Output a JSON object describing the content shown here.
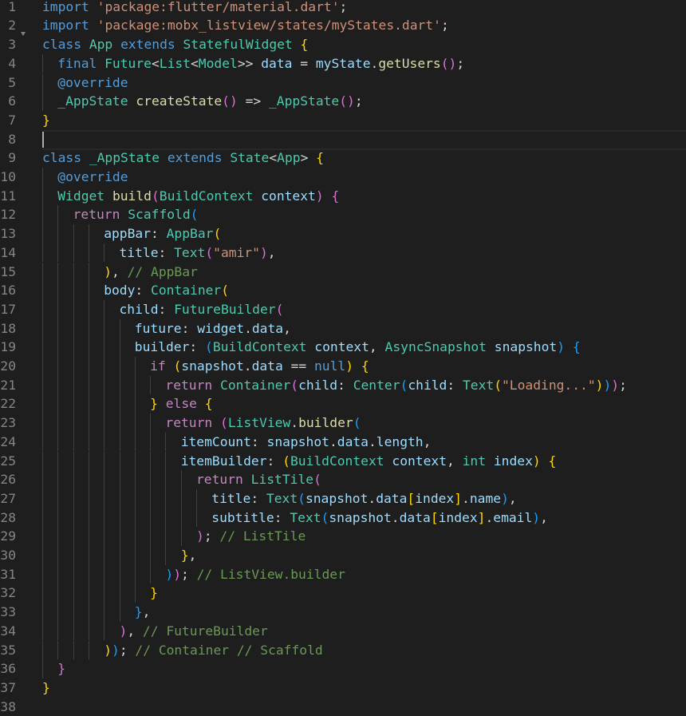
{
  "editor": {
    "language": "dart",
    "current_line": 8,
    "colors": {
      "background": "#1e1e1e",
      "keyword": "#569cd6",
      "control": "#c586c0",
      "type": "#4ec9b0",
      "function": "#dcdcaa",
      "variable": "#9cdcfe",
      "string": "#ce9178",
      "comment": "#6a9955",
      "punctuation": "#d4d4d4",
      "bracket_1": "#ffd700",
      "bracket_2": "#da70d6",
      "bracket_3": "#179fff",
      "line_number": "#858585"
    },
    "lines": [
      {
        "n": "1",
        "indent": 0,
        "tokens": [
          [
            "kw",
            "import"
          ],
          [
            "p",
            " "
          ],
          [
            "str",
            "'package:flutter/material.dart'"
          ],
          [
            "p",
            ";"
          ]
        ]
      },
      {
        "n": "2",
        "indent": 0,
        "tokens": [
          [
            "kw",
            "import"
          ],
          [
            "p",
            " "
          ],
          [
            "str",
            "'package:mobx_listview/states/myStates.dart'"
          ],
          [
            "p",
            ";"
          ]
        ]
      },
      {
        "n": "3",
        "indent": 0,
        "tokens": [
          [
            "kw",
            "class"
          ],
          [
            "p",
            " "
          ],
          [
            "type",
            "App"
          ],
          [
            "p",
            " "
          ],
          [
            "kw",
            "extends"
          ],
          [
            "p",
            " "
          ],
          [
            "type",
            "StatefulWidget"
          ],
          [
            "p",
            " "
          ],
          [
            "b1",
            "{"
          ]
        ]
      },
      {
        "n": "4",
        "indent": 1,
        "tokens": [
          [
            "kw",
            "final"
          ],
          [
            "p",
            " "
          ],
          [
            "type",
            "Future"
          ],
          [
            "p",
            "<"
          ],
          [
            "type",
            "List"
          ],
          [
            "p",
            "<"
          ],
          [
            "type",
            "Model"
          ],
          [
            "p",
            ">> "
          ],
          [
            "var",
            "data"
          ],
          [
            "p",
            " = "
          ],
          [
            "var",
            "myState"
          ],
          [
            "p",
            "."
          ],
          [
            "fn",
            "getUsers"
          ],
          [
            "b2",
            "()"
          ],
          [
            "p",
            ";"
          ]
        ]
      },
      {
        "n": "5",
        "indent": 1,
        "tokens": [
          [
            "kw",
            "@override"
          ]
        ]
      },
      {
        "n": "6",
        "indent": 1,
        "tokens": [
          [
            "type",
            "_AppState"
          ],
          [
            "p",
            " "
          ],
          [
            "fn",
            "createState"
          ],
          [
            "b2",
            "()"
          ],
          [
            "p",
            " => "
          ],
          [
            "type",
            "_AppState"
          ],
          [
            "b2",
            "()"
          ],
          [
            "p",
            ";"
          ]
        ]
      },
      {
        "n": "7",
        "indent": 0,
        "tokens": [
          [
            "b1",
            "}"
          ]
        ]
      },
      {
        "n": "8",
        "indent": 0,
        "tokens": []
      },
      {
        "n": "9",
        "indent": 0,
        "tokens": [
          [
            "kw",
            "class"
          ],
          [
            "p",
            " "
          ],
          [
            "type",
            "_AppState"
          ],
          [
            "p",
            " "
          ],
          [
            "kw",
            "extends"
          ],
          [
            "p",
            " "
          ],
          [
            "type",
            "State"
          ],
          [
            "p",
            "<"
          ],
          [
            "type",
            "App"
          ],
          [
            "p",
            "> "
          ],
          [
            "b1",
            "{"
          ]
        ]
      },
      {
        "n": "10",
        "indent": 1,
        "tokens": [
          [
            "kw",
            "@override"
          ]
        ]
      },
      {
        "n": "11",
        "indent": 1,
        "tokens": [
          [
            "type",
            "Widget"
          ],
          [
            "p",
            " "
          ],
          [
            "fn",
            "build"
          ],
          [
            "b2",
            "("
          ],
          [
            "type",
            "BuildContext"
          ],
          [
            "p",
            " "
          ],
          [
            "var",
            "context"
          ],
          [
            "b2",
            ")"
          ],
          [
            "p",
            " "
          ],
          [
            "b2",
            "{"
          ]
        ]
      },
      {
        "n": "12",
        "indent": 2,
        "tokens": [
          [
            "ctl",
            "return"
          ],
          [
            "p",
            " "
          ],
          [
            "type",
            "Scaffold"
          ],
          [
            "b3",
            "("
          ]
        ]
      },
      {
        "n": "13",
        "indent": 4,
        "tokens": [
          [
            "var",
            "appBar"
          ],
          [
            "p",
            ": "
          ],
          [
            "type",
            "AppBar"
          ],
          [
            "b1",
            "("
          ]
        ]
      },
      {
        "n": "14",
        "indent": 5,
        "tokens": [
          [
            "var",
            "title"
          ],
          [
            "p",
            ": "
          ],
          [
            "type",
            "Text"
          ],
          [
            "b2",
            "("
          ],
          [
            "str",
            "\"amir\""
          ],
          [
            "b2",
            ")"
          ],
          [
            "p",
            ","
          ]
        ]
      },
      {
        "n": "15",
        "indent": 4,
        "tokens": [
          [
            "b1",
            ")"
          ],
          [
            "p",
            ", "
          ],
          [
            "com",
            "// AppBar"
          ]
        ]
      },
      {
        "n": "16",
        "indent": 4,
        "tokens": [
          [
            "var",
            "body"
          ],
          [
            "p",
            ": "
          ],
          [
            "type",
            "Container"
          ],
          [
            "b1",
            "("
          ]
        ]
      },
      {
        "n": "17",
        "indent": 5,
        "tokens": [
          [
            "var",
            "child"
          ],
          [
            "p",
            ": "
          ],
          [
            "type",
            "FutureBuilder"
          ],
          [
            "b2",
            "("
          ]
        ]
      },
      {
        "n": "18",
        "indent": 6,
        "tokens": [
          [
            "var",
            "future"
          ],
          [
            "p",
            ": "
          ],
          [
            "var",
            "widget"
          ],
          [
            "p",
            "."
          ],
          [
            "var",
            "data"
          ],
          [
            "p",
            ","
          ]
        ]
      },
      {
        "n": "19",
        "indent": 6,
        "tokens": [
          [
            "var",
            "builder"
          ],
          [
            "p",
            ": "
          ],
          [
            "b3",
            "("
          ],
          [
            "type",
            "BuildContext"
          ],
          [
            "p",
            " "
          ],
          [
            "var",
            "context"
          ],
          [
            "p",
            ", "
          ],
          [
            "type",
            "AsyncSnapshot"
          ],
          [
            "p",
            " "
          ],
          [
            "var",
            "snapshot"
          ],
          [
            "b3",
            ")"
          ],
          [
            "p",
            " "
          ],
          [
            "b3",
            "{"
          ]
        ]
      },
      {
        "n": "20",
        "indent": 7,
        "tokens": [
          [
            "ctl",
            "if"
          ],
          [
            "p",
            " "
          ],
          [
            "b1",
            "("
          ],
          [
            "var",
            "snapshot"
          ],
          [
            "p",
            "."
          ],
          [
            "var",
            "data"
          ],
          [
            "p",
            " == "
          ],
          [
            "kw",
            "null"
          ],
          [
            "b1",
            ")"
          ],
          [
            "p",
            " "
          ],
          [
            "b1",
            "{"
          ]
        ]
      },
      {
        "n": "21",
        "indent": 8,
        "tokens": [
          [
            "ctl",
            "return"
          ],
          [
            "p",
            " "
          ],
          [
            "type",
            "Container"
          ],
          [
            "b2",
            "("
          ],
          [
            "var",
            "child"
          ],
          [
            "p",
            ": "
          ],
          [
            "type",
            "Center"
          ],
          [
            "b3",
            "("
          ],
          [
            "var",
            "child"
          ],
          [
            "p",
            ": "
          ],
          [
            "type",
            "Text"
          ],
          [
            "b1",
            "("
          ],
          [
            "str",
            "\"Loading...\""
          ],
          [
            "b1",
            ")"
          ],
          [
            "b3",
            ")"
          ],
          [
            "b2",
            ")"
          ],
          [
            "p",
            ";"
          ]
        ]
      },
      {
        "n": "22",
        "indent": 7,
        "tokens": [
          [
            "b1",
            "}"
          ],
          [
            "p",
            " "
          ],
          [
            "ctl",
            "else"
          ],
          [
            "p",
            " "
          ],
          [
            "b1",
            "{"
          ]
        ]
      },
      {
        "n": "23",
        "indent": 8,
        "tokens": [
          [
            "ctl",
            "return"
          ],
          [
            "p",
            " "
          ],
          [
            "b2",
            "("
          ],
          [
            "type",
            "ListView"
          ],
          [
            "p",
            "."
          ],
          [
            "fn",
            "builder"
          ],
          [
            "b3",
            "("
          ]
        ]
      },
      {
        "n": "24",
        "indent": 9,
        "tokens": [
          [
            "var",
            "itemCount"
          ],
          [
            "p",
            ": "
          ],
          [
            "var",
            "snapshot"
          ],
          [
            "p",
            "."
          ],
          [
            "var",
            "data"
          ],
          [
            "p",
            "."
          ],
          [
            "var",
            "length"
          ],
          [
            "p",
            ","
          ]
        ]
      },
      {
        "n": "25",
        "indent": 9,
        "tokens": [
          [
            "var",
            "itemBuilder"
          ],
          [
            "p",
            ": "
          ],
          [
            "b1",
            "("
          ],
          [
            "type",
            "BuildContext"
          ],
          [
            "p",
            " "
          ],
          [
            "var",
            "context"
          ],
          [
            "p",
            ", "
          ],
          [
            "type",
            "int"
          ],
          [
            "p",
            " "
          ],
          [
            "var",
            "index"
          ],
          [
            "b1",
            ")"
          ],
          [
            "p",
            " "
          ],
          [
            "b1",
            "{"
          ]
        ]
      },
      {
        "n": "26",
        "indent": 10,
        "tokens": [
          [
            "ctl",
            "return"
          ],
          [
            "p",
            " "
          ],
          [
            "type",
            "ListTile"
          ],
          [
            "b2",
            "("
          ]
        ]
      },
      {
        "n": "27",
        "indent": 11,
        "tokens": [
          [
            "var",
            "title"
          ],
          [
            "p",
            ": "
          ],
          [
            "type",
            "Text"
          ],
          [
            "b3",
            "("
          ],
          [
            "var",
            "snapshot"
          ],
          [
            "p",
            "."
          ],
          [
            "var",
            "data"
          ],
          [
            "b1",
            "["
          ],
          [
            "var",
            "index"
          ],
          [
            "b1",
            "]"
          ],
          [
            "p",
            "."
          ],
          [
            "var",
            "name"
          ],
          [
            "b3",
            ")"
          ],
          [
            "p",
            ","
          ]
        ]
      },
      {
        "n": "28",
        "indent": 11,
        "tokens": [
          [
            "var",
            "subtitle"
          ],
          [
            "p",
            ": "
          ],
          [
            "type",
            "Text"
          ],
          [
            "b3",
            "("
          ],
          [
            "var",
            "snapshot"
          ],
          [
            "p",
            "."
          ],
          [
            "var",
            "data"
          ],
          [
            "b1",
            "["
          ],
          [
            "var",
            "index"
          ],
          [
            "b1",
            "]"
          ],
          [
            "p",
            "."
          ],
          [
            "var",
            "email"
          ],
          [
            "b3",
            ")"
          ],
          [
            "p",
            ","
          ]
        ]
      },
      {
        "n": "29",
        "indent": 10,
        "tokens": [
          [
            "b2",
            ")"
          ],
          [
            "p",
            "; "
          ],
          [
            "com",
            "// ListTile"
          ]
        ]
      },
      {
        "n": "30",
        "indent": 9,
        "tokens": [
          [
            "b1",
            "}"
          ],
          [
            "p",
            ","
          ]
        ]
      },
      {
        "n": "31",
        "indent": 8,
        "tokens": [
          [
            "b3",
            ")"
          ],
          [
            "b2",
            ")"
          ],
          [
            "p",
            "; "
          ],
          [
            "com",
            "// ListView.builder"
          ]
        ]
      },
      {
        "n": "32",
        "indent": 7,
        "tokens": [
          [
            "b1",
            "}"
          ]
        ]
      },
      {
        "n": "33",
        "indent": 6,
        "tokens": [
          [
            "b3",
            "}"
          ],
          [
            "p",
            ","
          ]
        ]
      },
      {
        "n": "34",
        "indent": 5,
        "tokens": [
          [
            "b2",
            ")"
          ],
          [
            "p",
            ", "
          ],
          [
            "com",
            "// FutureBuilder"
          ]
        ]
      },
      {
        "n": "35",
        "indent": 4,
        "tokens": [
          [
            "b1",
            ")"
          ],
          [
            "b3",
            ")"
          ],
          [
            "p",
            "; "
          ],
          [
            "com",
            "// Container // Scaffold"
          ]
        ]
      },
      {
        "n": "36",
        "indent": 1,
        "tokens": [
          [
            "b2",
            "}"
          ]
        ]
      },
      {
        "n": "37",
        "indent": 0,
        "tokens": [
          [
            "b1",
            "}"
          ]
        ]
      },
      {
        "n": "38",
        "indent": 0,
        "tokens": []
      }
    ]
  }
}
